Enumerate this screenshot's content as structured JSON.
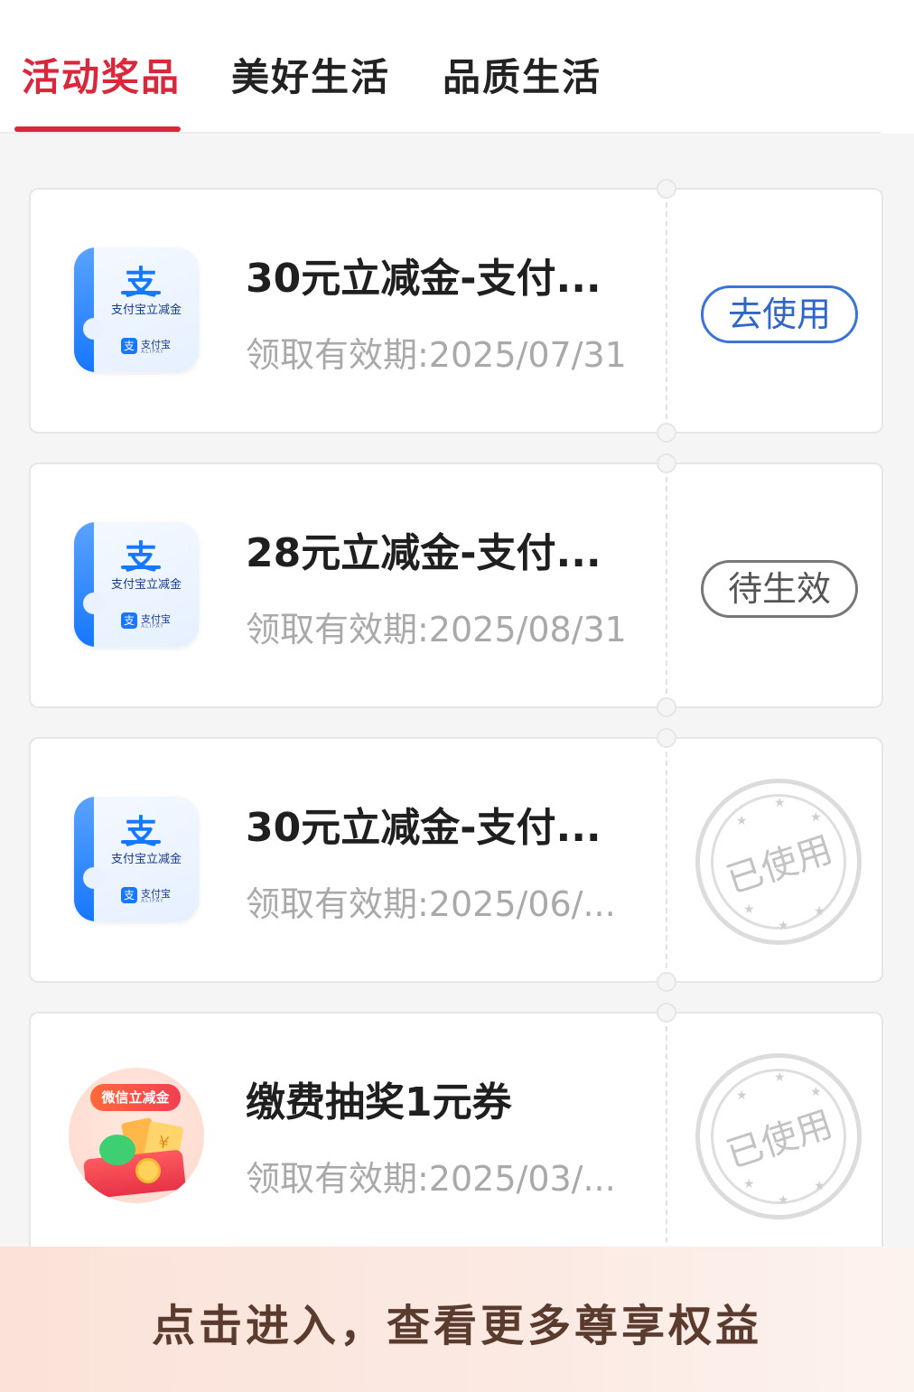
{
  "tabs": [
    {
      "label": "活动奖品",
      "active": true
    },
    {
      "label": "美好生活",
      "active": false
    },
    {
      "label": "品质生活",
      "active": false
    }
  ],
  "alipay_logo": {
    "glyph": "支",
    "caption": "支付宝立减金",
    "brand_cn": "支付宝",
    "brand_en": "ALIPAY"
  },
  "wechat_logo": {
    "badge": "微信立减金",
    "currency": "¥"
  },
  "coupons": [
    {
      "title": "30元立减金-支付...",
      "expiry": "领取有效期:2025/07/31",
      "status": "去使用",
      "status_type": "use"
    },
    {
      "title": "28元立减金-支付...",
      "expiry": "领取有效期:2025/08/31",
      "status": "待生效",
      "status_type": "pending"
    },
    {
      "title": "30元立减金-支付...",
      "expiry": "领取有效期:2025/06/...",
      "status": "已使用",
      "status_type": "used"
    },
    {
      "title": "缴费抽奖1元券",
      "expiry": "领取有效期:2025/03/...",
      "status": "已使用",
      "status_type": "used"
    }
  ],
  "banner": {
    "text": "点击进入，查看更多尊享权益"
  },
  "colors": {
    "accent": "#d9283c",
    "use_button": "#2f66c8",
    "expiry_text": "#a9a9a9"
  }
}
